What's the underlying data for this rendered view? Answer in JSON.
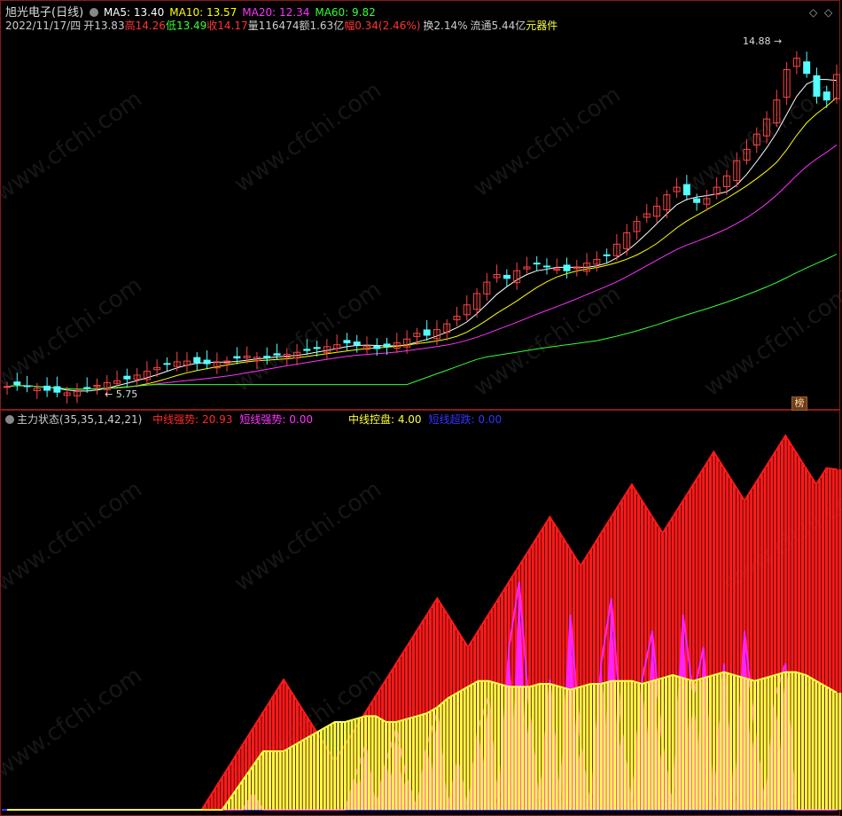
{
  "top": {
    "title": "旭光电子",
    "period": "(日线)",
    "ma": [
      {
        "label": "MA5:",
        "value": "13.40",
        "color": "#ffffff"
      },
      {
        "label": "MA10:",
        "value": "13.57",
        "color": "#ffff00"
      },
      {
        "label": "MA20:",
        "value": "12.34",
        "color": "#ff33ff"
      },
      {
        "label": "MA60:",
        "value": "9.82",
        "color": "#33ff33"
      }
    ],
    "info": [
      {
        "text": "2022/11/17/四",
        "color": "#cccccc"
      },
      {
        "text": "开13.83",
        "color": "#cccccc"
      },
      {
        "text": "高14.26",
        "color": "#ff3333"
      },
      {
        "text": "低13.49",
        "color": "#33ff33"
      },
      {
        "text": "收14.17",
        "color": "#ff3333"
      },
      {
        "text": "量116474",
        "color": "#cccccc"
      },
      {
        "text": "额1.63亿",
        "color": "#cccccc"
      },
      {
        "text": "幅0.34(2.46%)",
        "color": "#ff3333"
      },
      {
        "text": "换2.14%",
        "color": "#cccccc"
      },
      {
        "text": "流通5.44亿",
        "color": "#cccccc"
      },
      {
        "text": "元器件",
        "color": "#ffff33"
      }
    ],
    "high_mark": "14.88",
    "low_mark": "5.75",
    "rank_badge": "榜"
  },
  "bottom": {
    "indicator": "主力状态(35,35,1,42,21)",
    "values": [
      {
        "label": "中线强势:",
        "value": "20.93",
        "color": "#ff2a2a"
      },
      {
        "label": "短线强势:",
        "value": "0.00",
        "color": "#ff33ff"
      },
      {
        "label": "中线控盘:",
        "value": "4.00",
        "color": "#ffff33"
      },
      {
        "label": "短线超跌:",
        "value": "0.00",
        "color": "#3333ff"
      }
    ]
  },
  "watermark": "www.cfchi.com",
  "chart_data": [
    {
      "type": "candlestick",
      "title": "旭光电子 (日线)",
      "series": [
        {
          "name": "MA5"
        },
        {
          "name": "MA10"
        },
        {
          "name": "MA20"
        },
        {
          "name": "MA60"
        }
      ],
      "close": [
        5.95,
        6.0,
        5.95,
        5.9,
        5.85,
        5.8,
        5.78,
        5.82,
        5.9,
        5.98,
        6.05,
        6.1,
        6.15,
        6.25,
        6.35,
        6.45,
        6.55,
        6.6,
        6.62,
        6.58,
        6.55,
        6.6,
        6.62,
        6.7,
        6.75,
        6.72,
        6.7,
        6.78,
        6.8,
        6.85,
        6.9,
        6.95,
        7.0,
        7.05,
        7.1,
        7.05,
        7.0,
        6.95,
        7.0,
        7.1,
        7.2,
        7.35,
        7.3,
        7.45,
        7.6,
        7.8,
        8.1,
        8.4,
        8.7,
        8.9,
        8.8,
        9.0,
        9.1,
        9.2,
        9.1,
        9.05,
        9.0,
        9.1,
        9.2,
        9.3,
        9.4,
        9.7,
        10.0,
        10.3,
        10.5,
        10.7,
        11.0,
        11.2,
        11.0,
        10.8,
        10.9,
        11.2,
        11.5,
        11.9,
        12.2,
        12.6,
        13.0,
        13.5,
        14.3,
        14.6,
        14.2,
        13.6,
        13.5,
        14.17
      ],
      "ma_current": {
        "MA5": 13.4,
        "MA10": 13.57,
        "MA20": 12.34,
        "MA60": 9.82
      },
      "annotations": [
        "14.88",
        "5.75"
      ]
    },
    {
      "type": "bar",
      "title": "主力状态(35,35,1,42,21)",
      "series": [
        {
          "name": "中线强势",
          "values": [
            0,
            0,
            0,
            0,
            0,
            0,
            0,
            0,
            0,
            0,
            0,
            0,
            0,
            0,
            0,
            0,
            0,
            0,
            0,
            0,
            1,
            2,
            3,
            4,
            5,
            6,
            7,
            8,
            7,
            6,
            5,
            4,
            3,
            4,
            5,
            6,
            7,
            8,
            9,
            10,
            11,
            12,
            13,
            12,
            11,
            10,
            11,
            12,
            13,
            14,
            15,
            16,
            17,
            18,
            17,
            16,
            15,
            16,
            17,
            18,
            19,
            20,
            19,
            18,
            17,
            18,
            19,
            20,
            21,
            22,
            21,
            20,
            19,
            20,
            21,
            22,
            23,
            22,
            21,
            20,
            21,
            20.93
          ]
        },
        {
          "name": "短线强势",
          "values": [
            0,
            0,
            0,
            0,
            0,
            0,
            0,
            0,
            0,
            0,
            0,
            0,
            0,
            0,
            0,
            0,
            0,
            0,
            0,
            0,
            0,
            0,
            0,
            0,
            1,
            0,
            0,
            0,
            0,
            0,
            0,
            0,
            0,
            0,
            2,
            4,
            0,
            3,
            5,
            2,
            0,
            4,
            6,
            0,
            3,
            0,
            5,
            7,
            0,
            10,
            14,
            6,
            0,
            8,
            0,
            12,
            4,
            0,
            9,
            13,
            5,
            0,
            8,
            11,
            4,
            0,
            12,
            7,
            10,
            0,
            9,
            0,
            11,
            5,
            0,
            7,
            9,
            0,
            0,
            0,
            0,
            0
          ]
        },
        {
          "name": "中线控盘",
          "values": [
            0,
            0,
            0,
            0,
            0,
            0,
            0,
            0,
            0,
            0,
            0,
            0,
            0,
            0,
            0,
            0,
            0,
            0,
            0,
            0,
            0,
            0,
            0.5,
            1,
            1.5,
            2,
            2,
            2,
            2.2,
            2.4,
            2.6,
            2.8,
            3,
            3,
            3.1,
            3.2,
            3.2,
            3,
            3,
            3.1,
            3.2,
            3.3,
            3.5,
            3.8,
            4,
            4.2,
            4.4,
            4.4,
            4.3,
            4.2,
            4.2,
            4.2,
            4.3,
            4.3,
            4.2,
            4.1,
            4.2,
            4.3,
            4.3,
            4.4,
            4.4,
            4.4,
            4.3,
            4.4,
            4.5,
            4.6,
            4.5,
            4.4,
            4.5,
            4.6,
            4.7,
            4.6,
            4.5,
            4.4,
            4.5,
            4.6,
            4.7,
            4.7,
            4.6,
            4.4,
            4.2,
            4.0
          ]
        },
        {
          "name": "短线超跌",
          "values": [
            0
          ]
        }
      ]
    }
  ]
}
